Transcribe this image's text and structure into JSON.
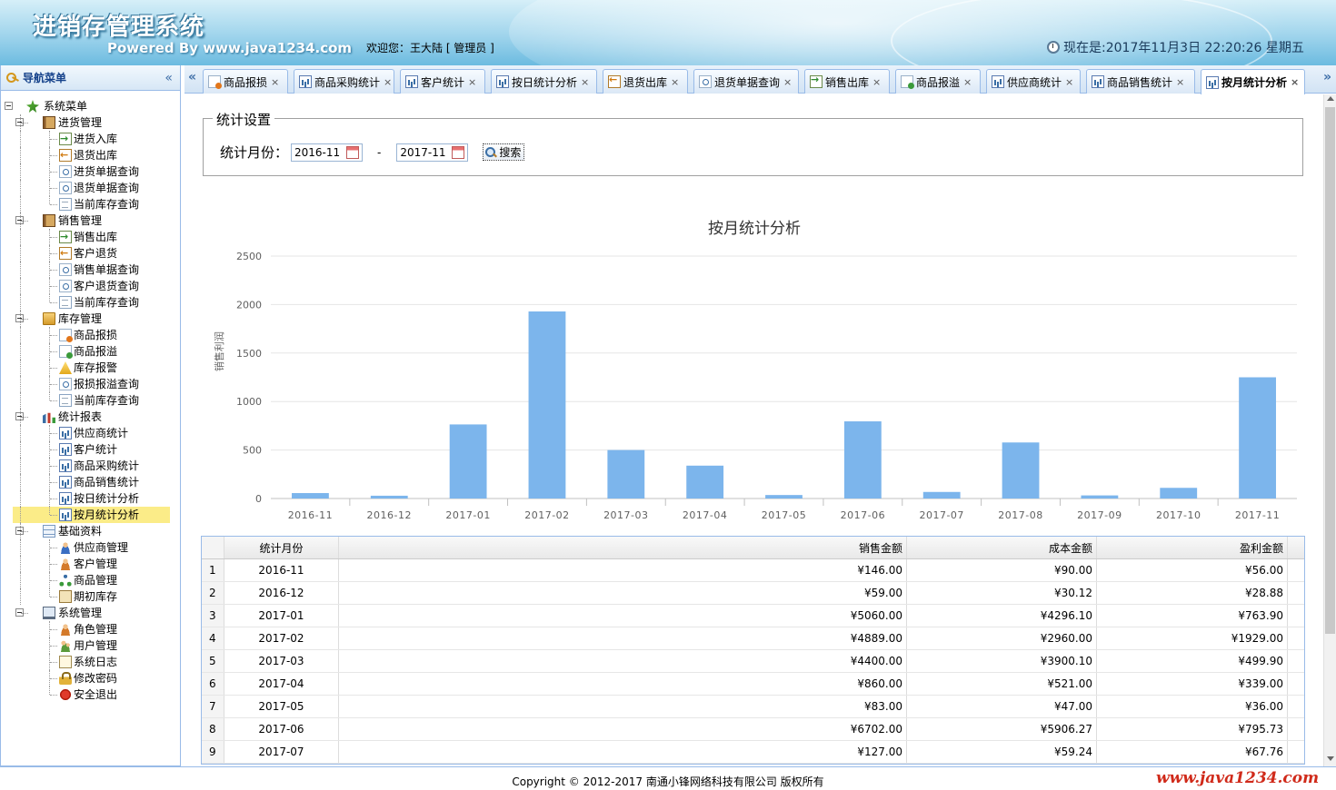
{
  "header": {
    "title": "进销存管理系统",
    "powered": "Powered By www.java1234.com",
    "welcome": "欢迎您：王大陆 [ 管理员 ]",
    "clock": "现在是:2017年11月3日 22:20:26 星期五"
  },
  "sidebar": {
    "title": "导航菜单",
    "collapse_glyph": "«",
    "tree": [
      {
        "label": "系统菜单",
        "icon": "root-icon",
        "level": 0
      },
      {
        "label": "进货管理",
        "icon": "book-icon",
        "level": 1
      },
      {
        "label": "进货入库",
        "icon": "stock-in-icon",
        "level": 2
      },
      {
        "label": "退货出库",
        "icon": "stock-out-icon",
        "level": 2
      },
      {
        "label": "进货单据查询",
        "icon": "search-doc-icon",
        "level": 2
      },
      {
        "label": "退货单据查询",
        "icon": "search-doc-icon",
        "level": 2
      },
      {
        "label": "当前库存查询",
        "icon": "page-icon",
        "level": 2
      },
      {
        "label": "销售管理",
        "icon": "book-icon",
        "level": 1
      },
      {
        "label": "销售出库",
        "icon": "stock-in-icon",
        "level": 2
      },
      {
        "label": "客户退货",
        "icon": "stock-out-icon",
        "level": 2
      },
      {
        "label": "销售单据查询",
        "icon": "search-doc-icon",
        "level": 2
      },
      {
        "label": "客户退货查询",
        "icon": "search-doc-icon",
        "level": 2
      },
      {
        "label": "当前库存查询",
        "icon": "page-icon",
        "level": 2
      },
      {
        "label": "库存管理",
        "icon": "folder-icon",
        "level": 1
      },
      {
        "label": "商品报损",
        "icon": "damage-icon",
        "level": 2
      },
      {
        "label": "商品报溢",
        "icon": "overflow-icon",
        "level": 2
      },
      {
        "label": "库存报警",
        "icon": "warning-icon",
        "level": 2
      },
      {
        "label": "报损报溢查询",
        "icon": "search-doc-icon",
        "level": 2
      },
      {
        "label": "当前库存查询",
        "icon": "page-icon",
        "level": 2
      },
      {
        "label": "统计报表",
        "icon": "bars-icon",
        "level": 1
      },
      {
        "label": "供应商统计",
        "icon": "chart-icon",
        "level": 2
      },
      {
        "label": "客户统计",
        "icon": "chart-icon",
        "level": 2
      },
      {
        "label": "商品采购统计",
        "icon": "chart-icon",
        "level": 2
      },
      {
        "label": "商品销售统计",
        "icon": "chart-icon",
        "level": 2
      },
      {
        "label": "按日统计分析",
        "icon": "chart-icon",
        "level": 2
      },
      {
        "label": "按月统计分析",
        "icon": "chart-icon",
        "level": 2,
        "selected": true
      },
      {
        "label": "基础资料",
        "icon": "grid-icon",
        "level": 1
      },
      {
        "label": "供应商管理",
        "icon": "user-icon",
        "level": 2
      },
      {
        "label": "客户管理",
        "icon": "user-orange-icon",
        "level": 2
      },
      {
        "label": "商品管理",
        "icon": "tree-icon",
        "level": 2
      },
      {
        "label": "期初库存",
        "icon": "stock-icon",
        "level": 2
      },
      {
        "label": "系统管理",
        "icon": "monitor-icon",
        "level": 1
      },
      {
        "label": "角色管理",
        "icon": "user-orange-icon",
        "level": 2
      },
      {
        "label": "用户管理",
        "icon": "users-icon",
        "level": 2
      },
      {
        "label": "系统日志",
        "icon": "log-icon",
        "level": 2
      },
      {
        "label": "修改密码",
        "icon": "lock-icon",
        "level": 2
      },
      {
        "label": "安全退出",
        "icon": "exit-icon",
        "level": 2,
        "last": true
      }
    ]
  },
  "tabs": {
    "scroll_left": "«",
    "scroll_right": "»",
    "close_glyph": "×",
    "items": [
      {
        "label": "商品报损",
        "icon": "damage-icon"
      },
      {
        "label": "商品采购统计",
        "icon": "chart-icon"
      },
      {
        "label": "客户统计",
        "icon": "chart-icon"
      },
      {
        "label": "按日统计分析",
        "icon": "chart-icon"
      },
      {
        "label": "退货出库",
        "icon": "stock-out-icon"
      },
      {
        "label": "退货单据查询",
        "icon": "search-doc-icon"
      },
      {
        "label": "销售出库",
        "icon": "stock-in-icon"
      },
      {
        "label": "商品报溢",
        "icon": "overflow-icon"
      },
      {
        "label": "供应商统计",
        "icon": "chart-icon"
      },
      {
        "label": "商品销售统计",
        "icon": "chart-icon"
      },
      {
        "label": "按月统计分析",
        "icon": "chart-icon",
        "active": true
      }
    ]
  },
  "filter": {
    "legend": "统计设置",
    "label": "统计月份：",
    "start": "2016-11",
    "end": "2017-11",
    "separator": "-",
    "search_label": "搜索"
  },
  "chart_data": {
    "type": "bar",
    "title": "按月统计分析",
    "ylabel": "销售利润",
    "xlabel": "",
    "ylim": [
      0,
      2500
    ],
    "yticks": [
      0,
      500,
      1000,
      1500,
      2000,
      2500
    ],
    "categories": [
      "2016-11",
      "2016-12",
      "2017-01",
      "2017-02",
      "2017-03",
      "2017-04",
      "2017-05",
      "2017-06",
      "2017-07",
      "2017-08",
      "2017-09",
      "2017-10",
      "2017-11"
    ],
    "values": [
      56,
      28.88,
      763.9,
      1929,
      499.9,
      339,
      36,
      795.73,
      67.76,
      578,
      32,
      110,
      1250
    ],
    "color": "#7cb5ec",
    "grid": true
  },
  "table": {
    "columns": [
      "统计月份",
      "销售金额",
      "成本金额",
      "盈利金额"
    ],
    "rows": [
      {
        "n": "1",
        "month": "2016-11",
        "sales": "¥146.00",
        "cost": "¥90.00",
        "profit": "¥56.00"
      },
      {
        "n": "2",
        "month": "2016-12",
        "sales": "¥59.00",
        "cost": "¥30.12",
        "profit": "¥28.88"
      },
      {
        "n": "3",
        "month": "2017-01",
        "sales": "¥5060.00",
        "cost": "¥4296.10",
        "profit": "¥763.90"
      },
      {
        "n": "4",
        "month": "2017-02",
        "sales": "¥4889.00",
        "cost": "¥2960.00",
        "profit": "¥1929.00"
      },
      {
        "n": "5",
        "month": "2017-03",
        "sales": "¥4400.00",
        "cost": "¥3900.10",
        "profit": "¥499.90"
      },
      {
        "n": "6",
        "month": "2017-04",
        "sales": "¥860.00",
        "cost": "¥521.00",
        "profit": "¥339.00"
      },
      {
        "n": "7",
        "month": "2017-05",
        "sales": "¥83.00",
        "cost": "¥47.00",
        "profit": "¥36.00"
      },
      {
        "n": "8",
        "month": "2017-06",
        "sales": "¥6702.00",
        "cost": "¥5906.27",
        "profit": "¥795.73"
      },
      {
        "n": "9",
        "month": "2017-07",
        "sales": "¥127.00",
        "cost": "¥59.24",
        "profit": "¥67.76"
      }
    ]
  },
  "footer": {
    "copyright": "Copyright © 2012-2017 南通小锋网络科技有限公司 版权所有",
    "watermark": "www.java1234.com"
  }
}
